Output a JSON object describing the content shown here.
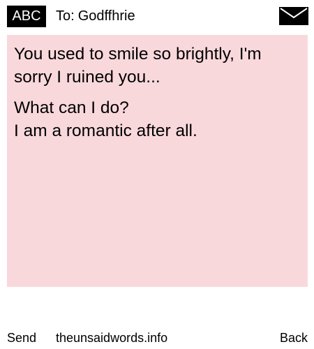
{
  "header": {
    "mode_badge": "ABC",
    "to_label": "To:",
    "recipient": "Godffhrie",
    "envelope_icon": "envelope-icon"
  },
  "message": {
    "paragraphs": [
      [
        "You used to smile so brightly, I'm",
        "sorry I ruined you..."
      ],
      [
        "What can I do?",
        "I am a romantic after all."
      ]
    ],
    "background_color": "#f9d8dc"
  },
  "footer": {
    "send_label": "Send",
    "site": "theunsaidwords.info",
    "back_label": "Back"
  }
}
